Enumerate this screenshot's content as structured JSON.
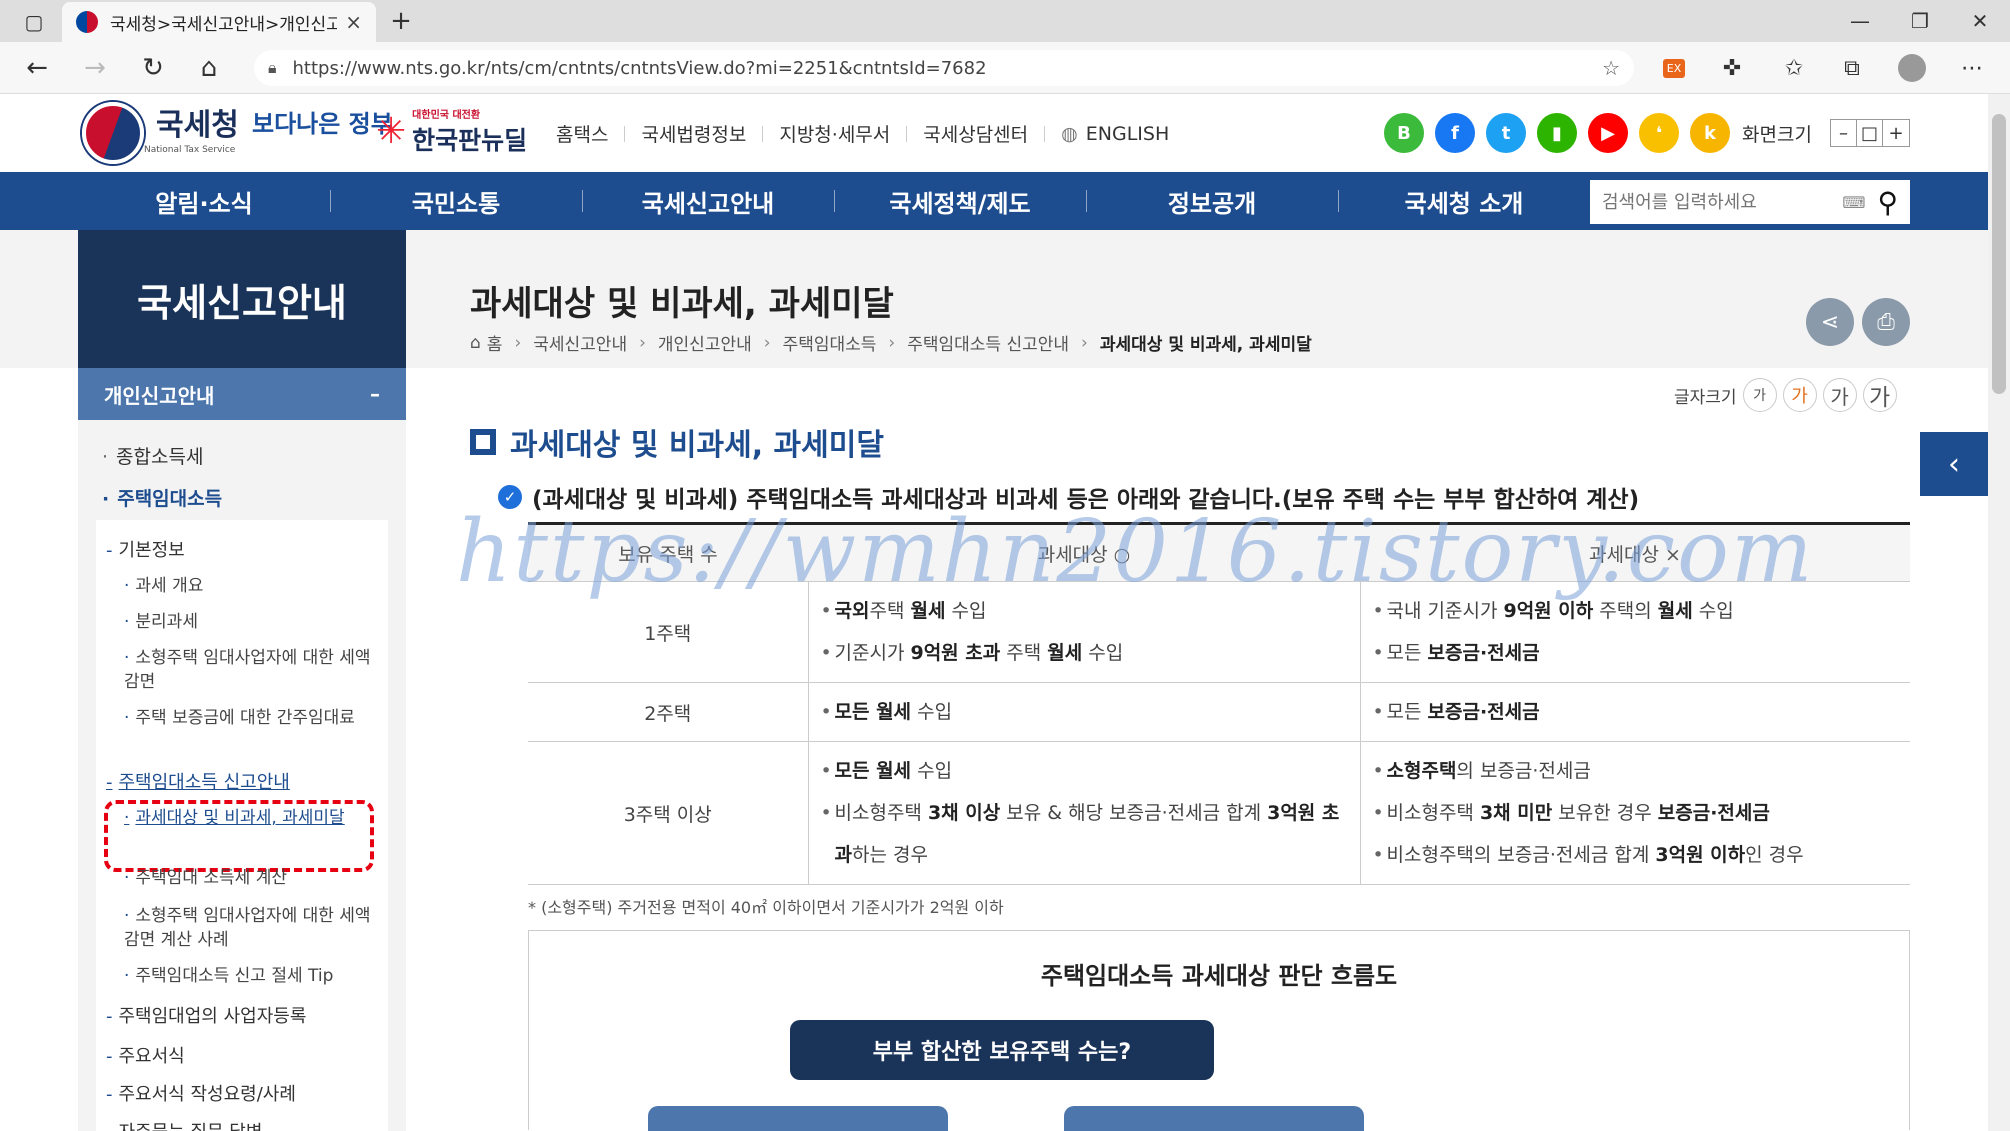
{
  "browser": {
    "tab_title": "국세청>국세신고안내>개인신고",
    "tab_close": "×",
    "new_tab": "+",
    "url": "https://www.nts.go.kr/nts/cm/cntnts/cntntsView.do?mi=2251&cntntsId=7682"
  },
  "header": {
    "logo_name": "국세청",
    "logo_sub": "National Tax Service",
    "slogan1": "보다나은 정부",
    "slogan2": "한국판뉴딜",
    "slogan2_sub": "대한민국 대전환",
    "top_nav": [
      "홈택스",
      "국세법령정보",
      "지방청·세무서",
      "국세상담센터",
      "ENGLISH"
    ],
    "social": [
      {
        "label": "B",
        "color": "#3cba3c"
      },
      {
        "label": "f",
        "color": "#1877f2"
      },
      {
        "label": "t",
        "color": "#1da1f2"
      },
      {
        "label": "▮",
        "color": "#2db400"
      },
      {
        "label": "▶",
        "color": "#ff0000"
      },
      {
        "label": "❛",
        "color": "#f9c000"
      },
      {
        "label": "k",
        "color": "#f7b500"
      }
    ],
    "zoom_label": "화면크기",
    "zoom_controls": [
      "–",
      "□",
      "+"
    ]
  },
  "gnb": {
    "items": [
      "알림·소식",
      "국민소통",
      "국세신고안내",
      "국세정책/제도",
      "정보공개",
      "국세청 소개"
    ],
    "search_placeholder": "검색어를 입력하세요"
  },
  "lnb": {
    "title": "국세신고안내",
    "sub_title": "개인신고안내",
    "sub_toggle": "–",
    "level1": [
      "종합소득세",
      "주택임대소득"
    ],
    "level2": [
      "기본정보",
      "주택임대소득 신고안내",
      "주택임대업의 사업자등록",
      "주요서식",
      "주요서식 작성요령/사례",
      "자주묻는 질문 답변"
    ],
    "level3_basic": [
      "과세 개요",
      "분리과세",
      "소형주택 임대사업자에 대한 세액 감면",
      "주택 보증금에 대한 간주임대료"
    ],
    "level3_report": [
      "과세대상 및 비과세, 과세미달",
      "주택임대 소득세 계산",
      "소형주택 임대사업자에 대한 세액감면 계산 사례",
      "주택임대소득 신고 절세 Tip"
    ]
  },
  "content": {
    "page_title": "과세대상 및 비과세, 과세미달",
    "breadcrumb": [
      "홈",
      "국세신고안내",
      "개인신고안내",
      "주택임대소득",
      "주택임대소득 신고안내",
      "과세대상 및 비과세, 과세미달"
    ],
    "font_size_label": "글자크기",
    "font_sizes": [
      "가",
      "가",
      "가",
      "가"
    ],
    "heading": "과세대상 및 비과세, 과세미달",
    "lead": "(과세대상 및 비과세) 주택임대소득 과세대상과 비과세 등은 아래와 같습니다.(보유 주택 수는 부부 합산하여 계산)",
    "table": {
      "headers": [
        "보유 주택 수",
        "과세대상 ○",
        "과세대상 ×"
      ],
      "rows": [
        {
          "count": "1주택",
          "taxable": [
            "<b>국외</b>주택 <b>월세</b> 수입",
            "기준시가 <b>9억원 초과</b> 주택 <b>월세</b> 수입"
          ],
          "nontaxable": [
            "국내 기준시가 <b>9억원 이하</b> 주택의 <b>월세</b> 수입",
            "모든 <b>보증금·전세금</b>"
          ]
        },
        {
          "count": "2주택",
          "taxable": [
            "<b>모든 월세</b> 수입"
          ],
          "nontaxable": [
            "모든 <b>보증금·전세금</b>"
          ]
        },
        {
          "count": "3주택 이상",
          "taxable": [
            "<b>모든 월세</b> 수입",
            "비소형주택 <b>3채 이상</b> 보유 & 해당 보증금·전세금 합계 <b>3억원 초과</b>하는 경우"
          ],
          "nontaxable": [
            "<b>소형주택</b>의 보증금·전세금",
            "비소형주택 <b>3채 미만</b> 보유한 경우 <b>보증금·전세금</b>",
            "비소형주택의 보증금·전세금 합계 <b>3억원 이하</b>인 경우"
          ]
        }
      ]
    },
    "note": "* (소형주택) 주거전용 면적이 40㎡ 이하이면서 기준시가가 2억원 이하",
    "flow_title": "주택임대소득 과세대상 판단 흐름도",
    "flow_question": "부부 합산한 보유주택 수는?"
  },
  "watermark": "https://wmhn2016.tistory.com"
}
